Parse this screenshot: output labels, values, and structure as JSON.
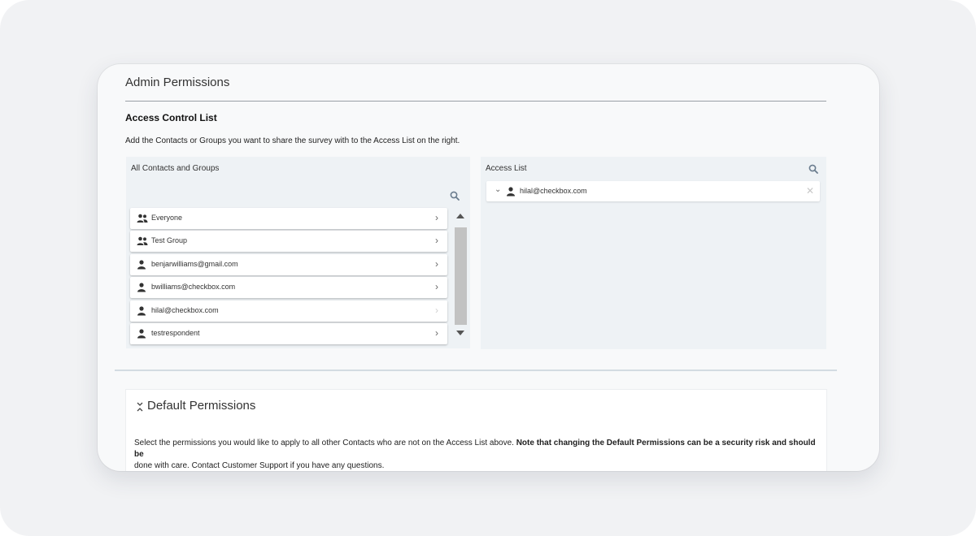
{
  "panel": {
    "title": "Admin Permissions"
  },
  "acl": {
    "title": "Access Control List",
    "description": "Add the Contacts or Groups you want to share the survey with to the Access List on the right."
  },
  "all_contacts": {
    "label": "All Contacts and Groups",
    "items": [
      {
        "label": "Everyone",
        "icon": "group-icon",
        "added": false
      },
      {
        "label": "Test Group",
        "icon": "group-icon",
        "added": false
      },
      {
        "label": "benjarwilliams@gmail.com",
        "icon": "user-icon",
        "added": false
      },
      {
        "label": "bwilliams@checkbox.com",
        "icon": "user-icon",
        "added": false
      },
      {
        "label": "hilal@checkbox.com",
        "icon": "user-icon",
        "added": true
      },
      {
        "label": "testrespondent",
        "icon": "user-icon",
        "added": false
      }
    ]
  },
  "access_list": {
    "label": "Access List",
    "items": [
      {
        "label": "hilal@checkbox.com",
        "icon": "user-icon"
      }
    ]
  },
  "default_permissions": {
    "title": "Default Permissions",
    "description_plain": "Select the permissions you would like to apply to all other Contacts who are not on the Access List above. ",
    "description_bold": "Note that changing the Default Permissions can be a security risk and should be",
    "description_cut": "done with care. Contact Customer Support if you have any questions."
  },
  "colors": {
    "page_bg": "#f1f2f4",
    "card_bg": "#f8f9fa",
    "box_bg": "#eef2f5",
    "scroll_thumb": "#c2c2c2"
  }
}
